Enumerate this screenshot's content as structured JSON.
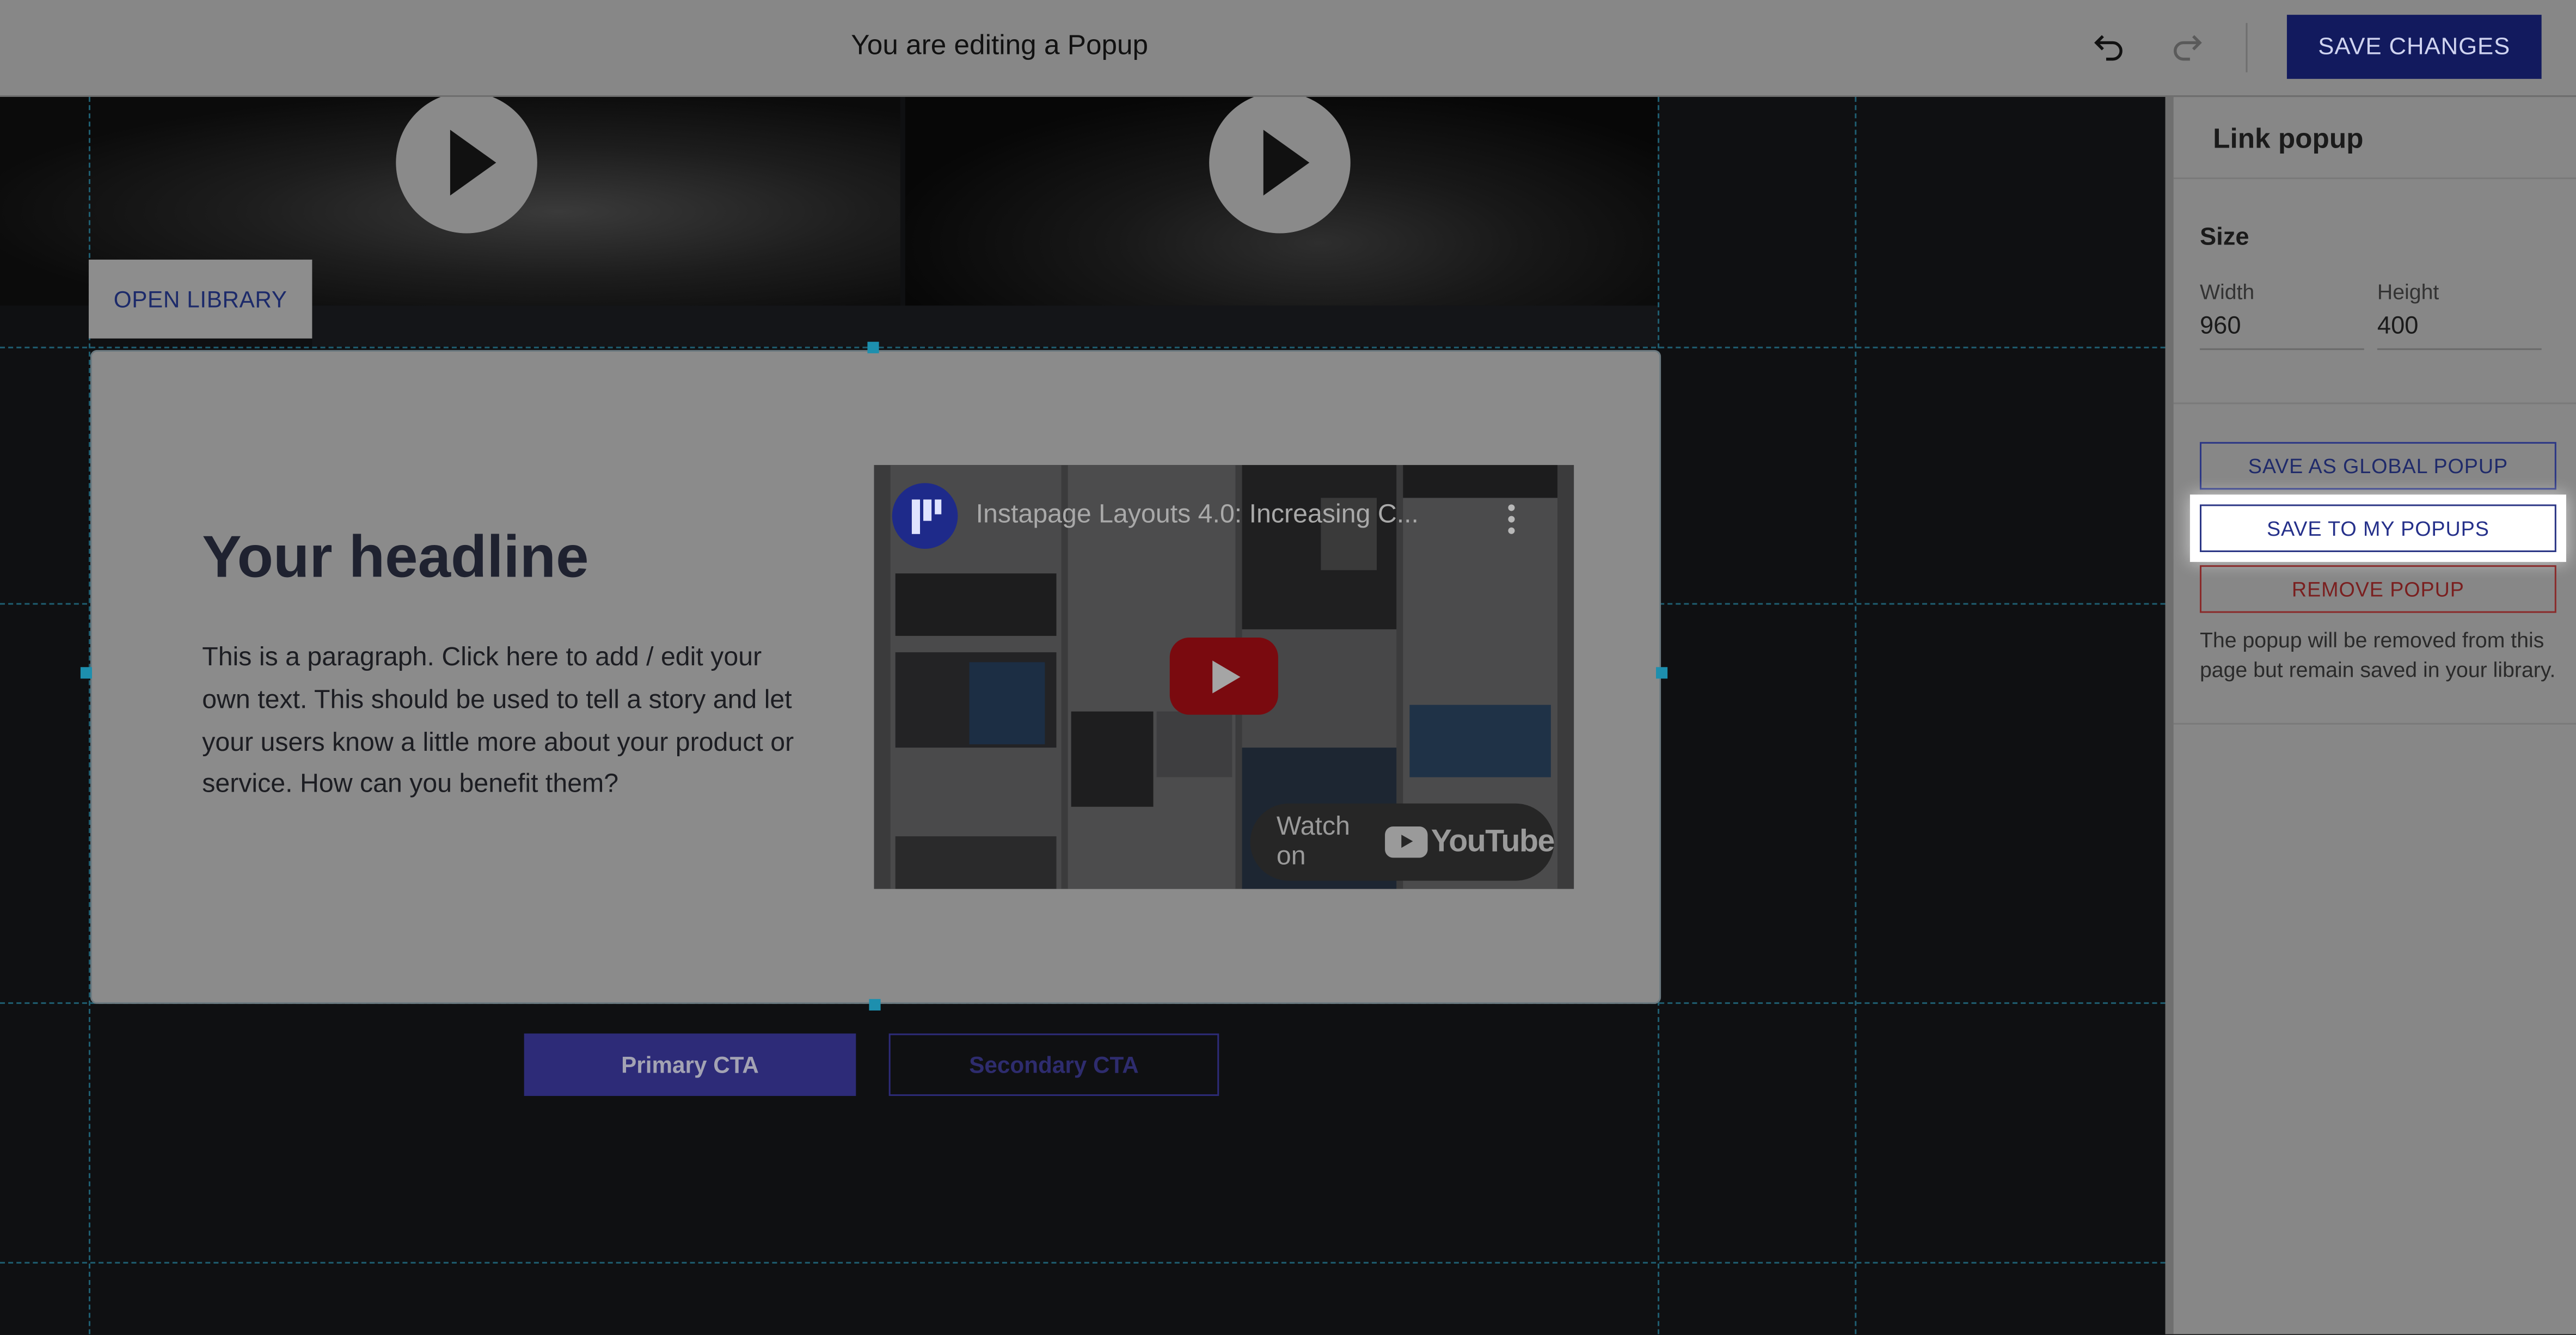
{
  "topbar": {
    "title": "You are editing a Popup",
    "save_label": "SAVE CHANGES"
  },
  "canvas": {
    "open_library_label": "OPEN LIBRARY",
    "popup": {
      "headline": "Your headline",
      "paragraph": "This is a paragraph. Click here to add / edit your own text. This should be used to tell a story and let your users know a little more about your product or service. How can you benefit them?",
      "video": {
        "title": "Instapage Layouts 4.0: Increasing C...",
        "watch_label": "Watch on",
        "brand": "YouTube"
      }
    },
    "primary_cta": "Primary CTA",
    "secondary_cta": "Secondary CTA"
  },
  "panel": {
    "title": "Link popup",
    "size_label": "Size",
    "width_label": "Width",
    "width_value": "960",
    "height_label": "Height",
    "height_value": "400",
    "save_global_label": "SAVE AS GLOBAL POPUP",
    "save_my_label": "SAVE TO MY POPUPS",
    "remove_label": "REMOVE POPUP",
    "remove_note": "The popup will be removed from this page but remain saved in your library."
  },
  "colors": {
    "accent": "#121a5e",
    "guide": "#1f5d70",
    "highlight": "#ffffff",
    "danger": "#7a1f1f"
  }
}
